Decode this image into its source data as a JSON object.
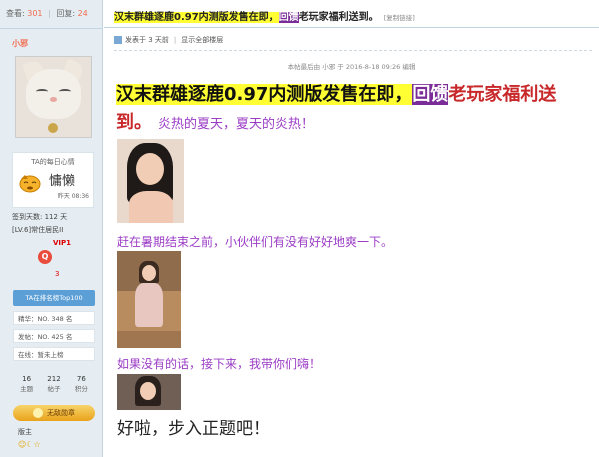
{
  "sidebar": {
    "stats": {
      "views_label": "查看:",
      "views": "301",
      "replies_label": "回复:",
      "replies": "24"
    },
    "username": "小邪",
    "mood": {
      "title": "TA的每日心情",
      "text": "慵懒",
      "time": "昨天 08:36"
    },
    "info": {
      "checkin": "签到天数: 112 天",
      "level": "[LV.6]常住居民II"
    },
    "vip": {
      "label": "VIP1",
      "icon": "Q",
      "number": "3"
    },
    "rank_button": "TA在排名榜Top100",
    "ranks": [
      {
        "label": "精华：NO. 348 名"
      },
      {
        "label": "发帖：NO. 425 名"
      },
      {
        "label": "在线：暂未上榜"
      }
    ],
    "counts": [
      {
        "value": "16",
        "label": "主题"
      },
      {
        "value": "212",
        "label": "帖子"
      },
      {
        "value": "76",
        "label": "积分"
      }
    ],
    "medal": "无敌勋章",
    "badge_label": "版主",
    "badge_icons": "☺☾☆"
  },
  "main": {
    "title": {
      "part1": "汉末群雄逐鹿0.97内测版发售在即，",
      "highlight": "回馈",
      "part2": "老玩家福利送到。",
      "copy_link": "[复制链接]"
    },
    "meta": {
      "posted": "发表于 3 天前",
      "show_all": "显示全部楼层"
    },
    "edited": "本帖最后由 小邪 于 2016-8-18 09:26 编辑",
    "headline": {
      "part1": "汉末群雄逐鹿0.97内测版发售在即，",
      "highlight": "回馈",
      "part2": "老玩家福利送到。",
      "sub": "炎热的夏天，夏天的炎热！"
    },
    "captions": [
      "赶在暑期结束之前，小伙伴们有没有好好地爽一下。",
      "如果没有的话，接下来，我带你们嗨！"
    ],
    "final": "好啦，步入正题吧！"
  },
  "colors": {
    "sidebar_bg": "#e5edf2",
    "accent_orange": "#f26c4f",
    "purple": "#9b3cc6",
    "highlight_yellow": "#ffff33",
    "highlight_purple": "#7a2d98"
  }
}
